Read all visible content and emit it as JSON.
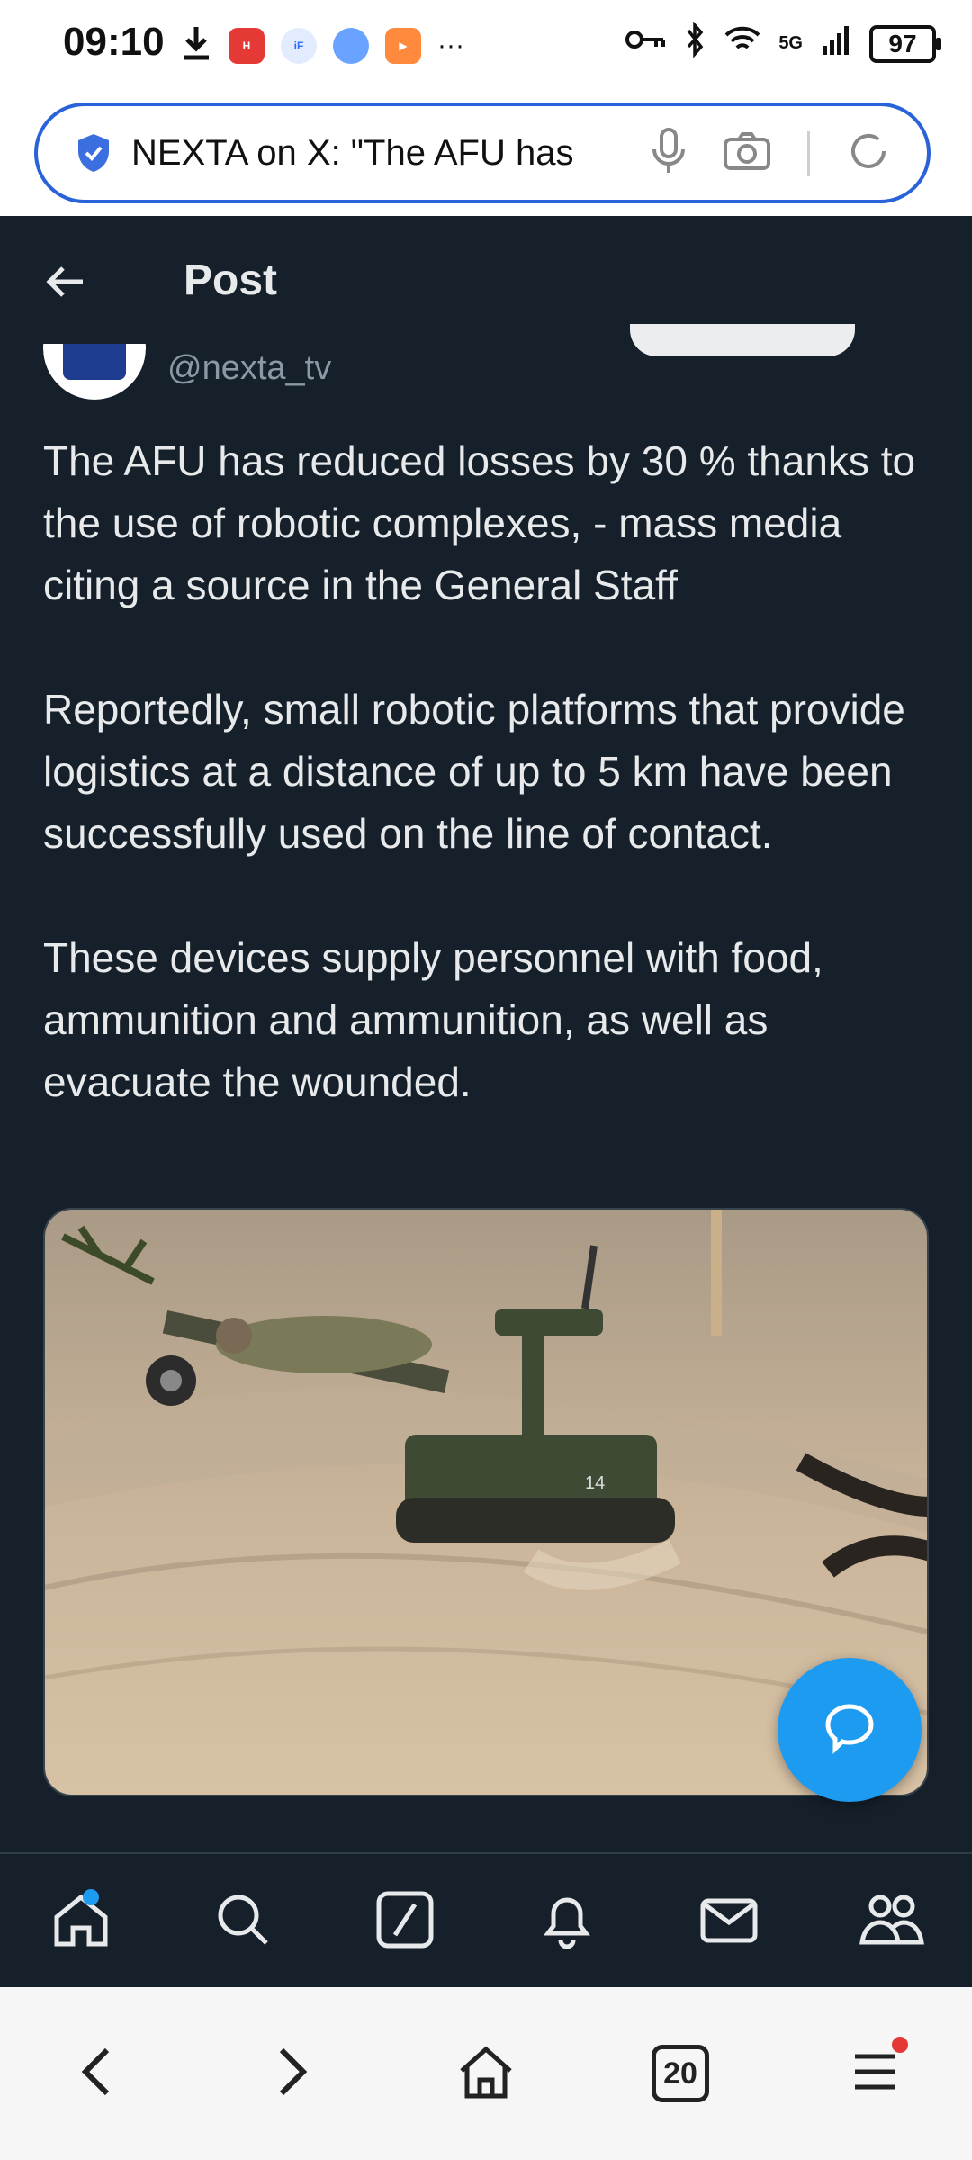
{
  "status_bar": {
    "time": "09:10",
    "network": "5G",
    "battery": "97"
  },
  "browser": {
    "url_title": "NEXTA on X: \"The AFU has",
    "tab_count": "20"
  },
  "x_app": {
    "header_title": "Post",
    "author_handle": "@nexta_tv",
    "tweet_paragraphs": [
      "The AFU has reduced losses by 30 % thanks to the use of robotic complexes, - mass media citing a source in the General Staff",
      "Reportedly, small robotic platforms that provide logistics at a distance of up to 5 km have been successfully used on the line of contact.",
      "These devices supply personnel with food, ammunition and ammunition, as well as evacuate the wounded."
    ],
    "media_marking": "14",
    "accent_color": "#1d9bf0",
    "background_color": "#15202b"
  },
  "icons": {
    "x_nav": [
      "home-icon",
      "search-icon",
      "grok-icon",
      "notifications-icon",
      "messages-icon",
      "communities-icon"
    ],
    "browser_nav": [
      "back-icon",
      "forward-icon",
      "home-icon",
      "tabs-icon",
      "menu-icon"
    ]
  }
}
